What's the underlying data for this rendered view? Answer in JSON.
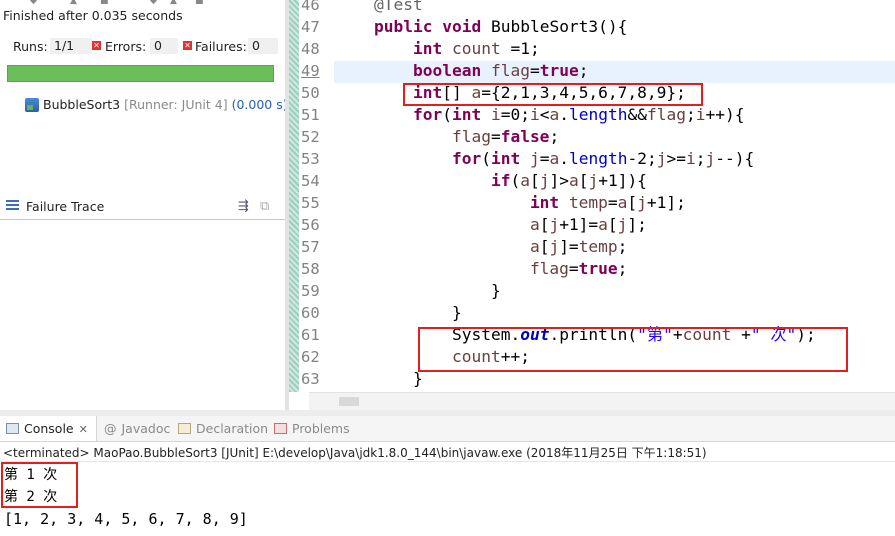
{
  "junit": {
    "finished": "Finished after 0.035 seconds",
    "runs_label": "Runs:",
    "runs_value": "1/1",
    "errors_label": "Errors:",
    "errors_value": "0",
    "failures_label": "Failures:",
    "failures_value": "0",
    "progress_color": "#6bbf5a",
    "test_name": "BubbleSort3",
    "test_runner": "[Runner: JUnit 4]",
    "test_time": "(0.000 s)",
    "failure_trace_label": "Failure Trace"
  },
  "editor": {
    "line_numbers": [
      "46",
      "47",
      "48",
      "49",
      "50",
      "51",
      "52",
      "53",
      "54",
      "55",
      "56",
      "57",
      "58",
      "59",
      "60",
      "61",
      "62",
      "63"
    ],
    "highlighted_line": "49"
  },
  "console": {
    "tabs": [
      {
        "label": "Console",
        "active": true
      },
      {
        "label": "Javadoc",
        "active": false
      },
      {
        "label": "Declaration",
        "active": false
      },
      {
        "label": "Problems",
        "active": false
      }
    ],
    "terminated": "<terminated> MaoPao.BubbleSort3 [JUnit] E:\\develop\\Java\\jdk1.8.0_144\\bin\\javaw.exe (2018年11月25日 下午1:18:51)",
    "output": [
      "第 1 次",
      "第 2 次",
      "[1, 2, 3, 4, 5, 6, 7, 8, 9]"
    ]
  },
  "colors": {
    "keyword": "#7f0055",
    "string": "#2a00ff",
    "field": "#0000c0",
    "annotation_box": "#e02020"
  }
}
